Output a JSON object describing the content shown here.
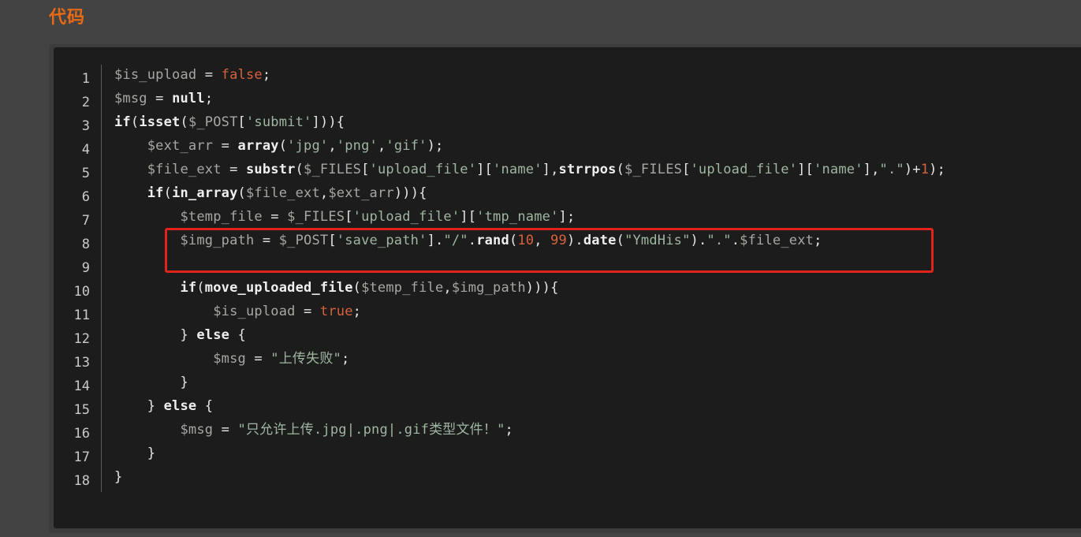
{
  "section_title": "代码",
  "line_numbers": [
    "1",
    "2",
    "3",
    "4",
    "5",
    "6",
    "7",
    "8",
    "9",
    "10",
    "11",
    "12",
    "13",
    "14",
    "15",
    "16",
    "17",
    "18"
  ],
  "code": {
    "l1": [
      [
        "var",
        "$is_upload"
      ],
      [
        "op",
        " = "
      ],
      [
        "bool",
        "false"
      ],
      [
        "op",
        ";"
      ]
    ],
    "l2": [
      [
        "var",
        "$msg"
      ],
      [
        "op",
        " = "
      ],
      [
        "kw",
        "null"
      ],
      [
        "op",
        ";"
      ]
    ],
    "l3": [
      [
        "kw",
        "if"
      ],
      [
        "op",
        "("
      ],
      [
        "fn",
        "isset"
      ],
      [
        "op",
        "("
      ],
      [
        "var",
        "$_POST"
      ],
      [
        "op",
        "["
      ],
      [
        "str",
        "'submit'"
      ],
      [
        "op",
        "])){"
      ]
    ],
    "l4": [
      [
        "op",
        "    "
      ],
      [
        "var",
        "$ext_arr"
      ],
      [
        "op",
        " = "
      ],
      [
        "fn",
        "array"
      ],
      [
        "op",
        "("
      ],
      [
        "str",
        "'jpg'"
      ],
      [
        "op",
        ","
      ],
      [
        "str",
        "'png'"
      ],
      [
        "op",
        ","
      ],
      [
        "str",
        "'gif'"
      ],
      [
        "op",
        ");"
      ]
    ],
    "l5": [
      [
        "op",
        "    "
      ],
      [
        "var",
        "$file_ext"
      ],
      [
        "op",
        " = "
      ],
      [
        "fn",
        "substr"
      ],
      [
        "op",
        "("
      ],
      [
        "var",
        "$_FILES"
      ],
      [
        "op",
        "["
      ],
      [
        "str",
        "'upload_file'"
      ],
      [
        "op",
        "]["
      ],
      [
        "str",
        "'name'"
      ],
      [
        "op",
        "],"
      ],
      [
        "fn",
        "strrpos"
      ],
      [
        "op",
        "("
      ],
      [
        "var",
        "$_FILES"
      ],
      [
        "op",
        "["
      ],
      [
        "str",
        "'upload_file'"
      ],
      [
        "op",
        "]["
      ],
      [
        "str",
        "'name'"
      ],
      [
        "op",
        "],"
      ],
      [
        "str",
        "\".\""
      ],
      [
        "op",
        ")+"
      ],
      [
        "num",
        "1"
      ],
      [
        "op",
        ");"
      ]
    ],
    "l6": [
      [
        "op",
        "    "
      ],
      [
        "kw",
        "if"
      ],
      [
        "op",
        "("
      ],
      [
        "fn",
        "in_array"
      ],
      [
        "op",
        "("
      ],
      [
        "var",
        "$file_ext"
      ],
      [
        "op",
        ","
      ],
      [
        "var",
        "$ext_arr"
      ],
      [
        "op",
        "))){"
      ]
    ],
    "l7": [
      [
        "op",
        "        "
      ],
      [
        "var",
        "$temp_file"
      ],
      [
        "op",
        " = "
      ],
      [
        "var",
        "$_FILES"
      ],
      [
        "op",
        "["
      ],
      [
        "str",
        "'upload_file'"
      ],
      [
        "op",
        "]["
      ],
      [
        "str",
        "'tmp_name'"
      ],
      [
        "op",
        "];"
      ]
    ],
    "l8": [
      [
        "op",
        "        "
      ],
      [
        "var",
        "$img_path"
      ],
      [
        "op",
        " = "
      ],
      [
        "var",
        "$_POST"
      ],
      [
        "op",
        "["
      ],
      [
        "str",
        "'save_path'"
      ],
      [
        "op",
        "]."
      ],
      [
        "str",
        "\"/\""
      ],
      [
        "op",
        "."
      ],
      [
        "fn",
        "rand"
      ],
      [
        "op",
        "("
      ],
      [
        "num",
        "10"
      ],
      [
        "op",
        ", "
      ],
      [
        "num",
        "99"
      ],
      [
        "op",
        ")."
      ],
      [
        "fn",
        "date"
      ],
      [
        "op",
        "("
      ],
      [
        "str",
        "\"YmdHis\""
      ],
      [
        "op",
        ")."
      ],
      [
        "str",
        "\".\""
      ],
      [
        "op",
        "."
      ],
      [
        "var",
        "$file_ext"
      ],
      [
        "op",
        ";"
      ]
    ],
    "l9": [],
    "l10": [
      [
        "op",
        "        "
      ],
      [
        "kw",
        "if"
      ],
      [
        "op",
        "("
      ],
      [
        "fn",
        "move_uploaded_file"
      ],
      [
        "op",
        "("
      ],
      [
        "var",
        "$temp_file"
      ],
      [
        "op",
        ","
      ],
      [
        "var",
        "$img_path"
      ],
      [
        "op",
        "))){"
      ]
    ],
    "l11": [
      [
        "op",
        "            "
      ],
      [
        "var",
        "$is_upload"
      ],
      [
        "op",
        " = "
      ],
      [
        "bool",
        "true"
      ],
      [
        "op",
        ";"
      ]
    ],
    "l12": [
      [
        "op",
        "        } "
      ],
      [
        "kw",
        "else"
      ],
      [
        "op",
        " {"
      ]
    ],
    "l13": [
      [
        "op",
        "            "
      ],
      [
        "var",
        "$msg"
      ],
      [
        "op",
        " = "
      ],
      [
        "str",
        "\"上传失败\""
      ],
      [
        "op",
        ";"
      ]
    ],
    "l14": [
      [
        "op",
        "        }"
      ]
    ],
    "l15": [
      [
        "op",
        "    } "
      ],
      [
        "kw",
        "else"
      ],
      [
        "op",
        " {"
      ]
    ],
    "l16": [
      [
        "op",
        "        "
      ],
      [
        "var",
        "$msg"
      ],
      [
        "op",
        " = "
      ],
      [
        "str",
        "\"只允许上传.jpg|.png|.gif类型文件！\""
      ],
      [
        "op",
        ";"
      ]
    ],
    "l17": [
      [
        "op",
        "    }"
      ]
    ],
    "l18": [
      [
        "op",
        "}"
      ]
    ]
  },
  "highlight": {
    "color": "#e0231c",
    "line_range": [
      8,
      9
    ]
  },
  "colors": {
    "title": "#e86a14",
    "background": "#434343",
    "code_background": "#1c1c1c"
  }
}
